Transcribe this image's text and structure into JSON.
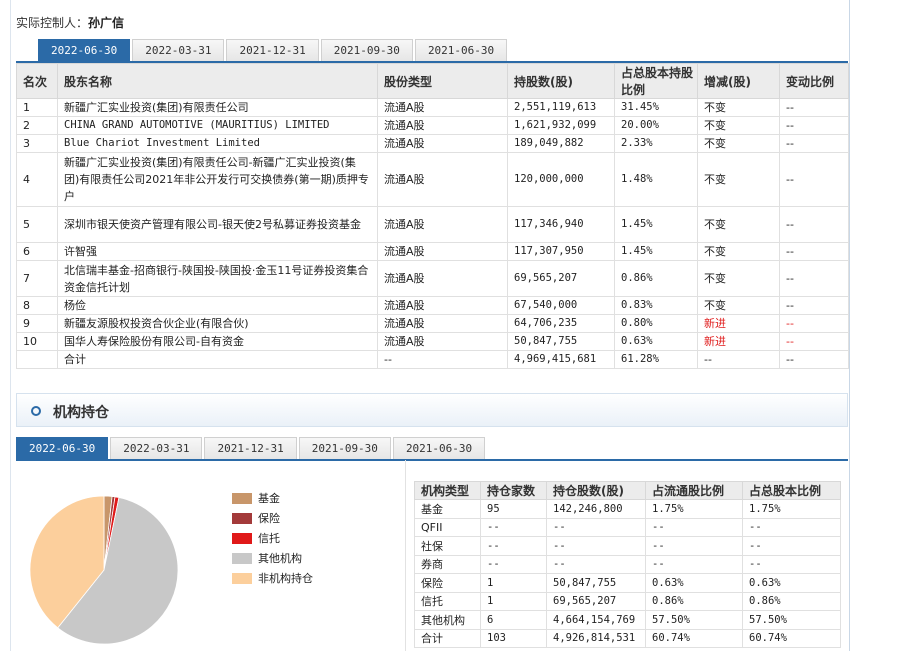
{
  "controller": {
    "label": "实际控制人：",
    "name": "孙广信"
  },
  "holder_tabs": [
    "2022-06-30",
    "2022-03-31",
    "2021-12-31",
    "2021-09-30",
    "2021-06-30"
  ],
  "holder_columns": [
    "名次",
    "股东名称",
    "股份类型",
    "持股数(股)",
    "占总股本持股比例",
    "增减(股)",
    "变动比例"
  ],
  "holders": [
    {
      "rank": "1",
      "name": "新疆广汇实业投资(集团)有限责任公司",
      "type": "流通A股",
      "shares": "2,551,119,613",
      "ratio": "31.45%",
      "change": "不变",
      "change_ratio": "--"
    },
    {
      "rank": "2",
      "name": "CHINA GRAND AUTOMOTIVE (MAURITIUS) LIMITED",
      "type": "流通A股",
      "shares": "1,621,932,099",
      "ratio": "20.00%",
      "change": "不变",
      "change_ratio": "--"
    },
    {
      "rank": "3",
      "name": "Blue Chariot Investment Limited",
      "type": "流通A股",
      "shares": "189,049,882",
      "ratio": "2.33%",
      "change": "不变",
      "change_ratio": "--"
    },
    {
      "rank": "4",
      "name": "新疆广汇实业投资(集团)有限责任公司-新疆广汇实业投资(集团)有限责任公司2021年非公开发行可交换债券(第一期)质押专户",
      "type": "流通A股",
      "shares": "120,000,000",
      "ratio": "1.48%",
      "change": "不变",
      "change_ratio": "--"
    },
    {
      "rank": "5",
      "name": "深圳市银天使资产管理有限公司-银天使2号私募证券投资基金",
      "type": "流通A股",
      "shares": "117,346,940",
      "ratio": "1.45%",
      "change": "不变",
      "change_ratio": "--"
    },
    {
      "rank": "6",
      "name": "许智强",
      "type": "流通A股",
      "shares": "117,307,950",
      "ratio": "1.45%",
      "change": "不变",
      "change_ratio": "--"
    },
    {
      "rank": "7",
      "name": "北信瑞丰基金-招商银行-陕国投-陕国投·金玉11号证券投资集合资金信托计划",
      "type": "流通A股",
      "shares": "69,565,207",
      "ratio": "0.86%",
      "change": "不变",
      "change_ratio": "--"
    },
    {
      "rank": "8",
      "name": "杨俭",
      "type": "流通A股",
      "shares": "67,540,000",
      "ratio": "0.83%",
      "change": "不变",
      "change_ratio": "--"
    },
    {
      "rank": "9",
      "name": "新疆友源股权投资合伙企业(有限合伙)",
      "type": "流通A股",
      "shares": "64,706,235",
      "ratio": "0.80%",
      "change": "新进",
      "change_ratio": "--"
    },
    {
      "rank": "10",
      "name": "国华人寿保险股份有限公司-自有资金",
      "type": "流通A股",
      "shares": "50,847,755",
      "ratio": "0.63%",
      "change": "新进",
      "change_ratio": "--"
    },
    {
      "rank": "",
      "name": "合计",
      "type": "--",
      "shares": "4,969,415,681",
      "ratio": "61.28%",
      "change": "--",
      "change_ratio": "--"
    }
  ],
  "institution": {
    "title": "机构持仓",
    "tabs": [
      "2022-06-30",
      "2022-03-31",
      "2021-12-31",
      "2021-09-30",
      "2021-06-30"
    ],
    "legend": [
      {
        "label": "基金",
        "color": "#c8966a"
      },
      {
        "label": "保险",
        "color": "#a33a3a"
      },
      {
        "label": "信托",
        "color": "#e01919"
      },
      {
        "label": "其他机构",
        "color": "#c8c8c8"
      },
      {
        "label": "非机构持仓",
        "color": "#fccf9c"
      }
    ],
    "columns": [
      "机构类型",
      "持仓家数",
      "持仓股数(股)",
      "占流通股比例",
      "占总股本比例"
    ],
    "rows": [
      [
        "基金",
        "95",
        "142,246,800",
        "1.75%",
        "1.75%"
      ],
      [
        "QFII",
        "--",
        "--",
        "--",
        "--"
      ],
      [
        "社保",
        "--",
        "--",
        "--",
        "--"
      ],
      [
        "券商",
        "--",
        "--",
        "--",
        "--"
      ],
      [
        "保险",
        "1",
        "50,847,755",
        "0.63%",
        "0.63%"
      ],
      [
        "信托",
        "1",
        "69,565,207",
        "0.86%",
        "0.86%"
      ],
      [
        "其他机构",
        "6",
        "4,664,154,769",
        "57.50%",
        "57.50%"
      ],
      [
        "合计",
        "103",
        "4,926,814,531",
        "60.74%",
        "60.74%"
      ]
    ],
    "pie_values": [
      1.75,
      0.63,
      0.86,
      57.5,
      39.26
    ]
  }
}
